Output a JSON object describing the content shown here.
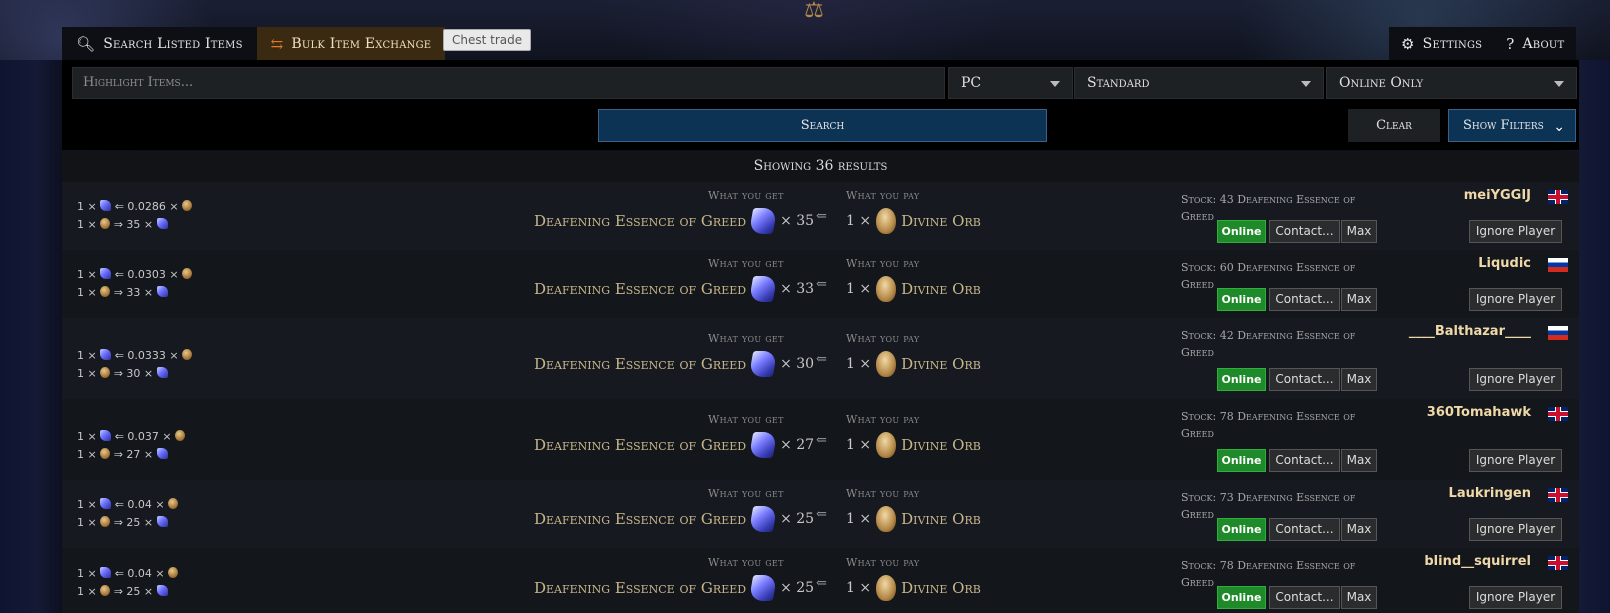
{
  "tabs": {
    "search_listed": "Search Listed Items",
    "bulk_exchange": "Bulk Item Exchange",
    "chest_trade": "Chest trade",
    "settings": "Settings",
    "about": "About"
  },
  "filters": {
    "highlight_placeholder": "Highlight Items...",
    "platform": "PC",
    "league": "Standard",
    "status": "Online Only"
  },
  "actions": {
    "search": "Search",
    "clear": "Clear",
    "show_filters": "Show Filters"
  },
  "results_header": "Showing 36 results",
  "labels": {
    "what_you_get": "What you get",
    "what_you_pay": "What you pay",
    "get_item": "Deafening Essence of Greed",
    "pay_item": "Divine Orb",
    "online": "Online",
    "contact": "Contact...",
    "max": "Max",
    "ignore": "Ignore Player",
    "arrow": "⇐"
  },
  "listings": [
    {
      "ratio_line1": "1 × ",
      "ratio_price": " ⇐ 0.0286 × ",
      "ratio_line2_a": "1 × ",
      "ratio_line2_b": " ⇒ 35 × ",
      "get_qty": "× 35",
      "pay_qty": "1 ×",
      "stock": "Stock: 43 Deafening Essence of Greed",
      "seller": "meiYGGIJ",
      "flag": "uk"
    },
    {
      "ratio_line1": "1 × ",
      "ratio_price": " ⇐ 0.0303 × ",
      "ratio_line2_a": "1 × ",
      "ratio_line2_b": " ⇒ 33 × ",
      "get_qty": "× 33",
      "pay_qty": "1 ×",
      "stock": "Stock: 60 Deafening Essence of Greed",
      "seller": "Liqudic",
      "flag": "ru"
    },
    {
      "ratio_line1": "1 × ",
      "ratio_price": " ⇐ 0.0333 × ",
      "ratio_line2_a": "1 × ",
      "ratio_line2_b": " ⇒ 30 × ",
      "get_qty": "× 30",
      "pay_qty": "1 ×",
      "stock": "Stock: 42 Deafening Essence of Greed",
      "seller": "____Balthazar____",
      "flag": "ru"
    },
    {
      "ratio_line1": "1 × ",
      "ratio_price": " ⇐ 0.037 × ",
      "ratio_line2_a": "1 × ",
      "ratio_line2_b": " ⇒ 27 × ",
      "get_qty": "× 27",
      "pay_qty": "1 ×",
      "stock": "Stock: 78 Deafening Essence of Greed",
      "seller": "360Tomahawk",
      "flag": "uk"
    },
    {
      "ratio_line1": "1 × ",
      "ratio_price": " ⇐ 0.04 × ",
      "ratio_line2_a": "1 × ",
      "ratio_line2_b": " ⇒ 25 × ",
      "get_qty": "× 25",
      "pay_qty": "1 ×",
      "stock": "Stock: 73 Deafening Essence of Greed",
      "seller": "Laukringen",
      "flag": "uk"
    },
    {
      "ratio_line1": "1 × ",
      "ratio_price": " ⇐ 0.04 × ",
      "ratio_line2_a": "1 × ",
      "ratio_line2_b": " ⇒ 25 × ",
      "get_qty": "× 25",
      "pay_qty": "1 ×",
      "stock": "Stock: 78 Deafening Essence of Greed",
      "seller": "blind__squirrel",
      "flag": "uk"
    }
  ]
}
